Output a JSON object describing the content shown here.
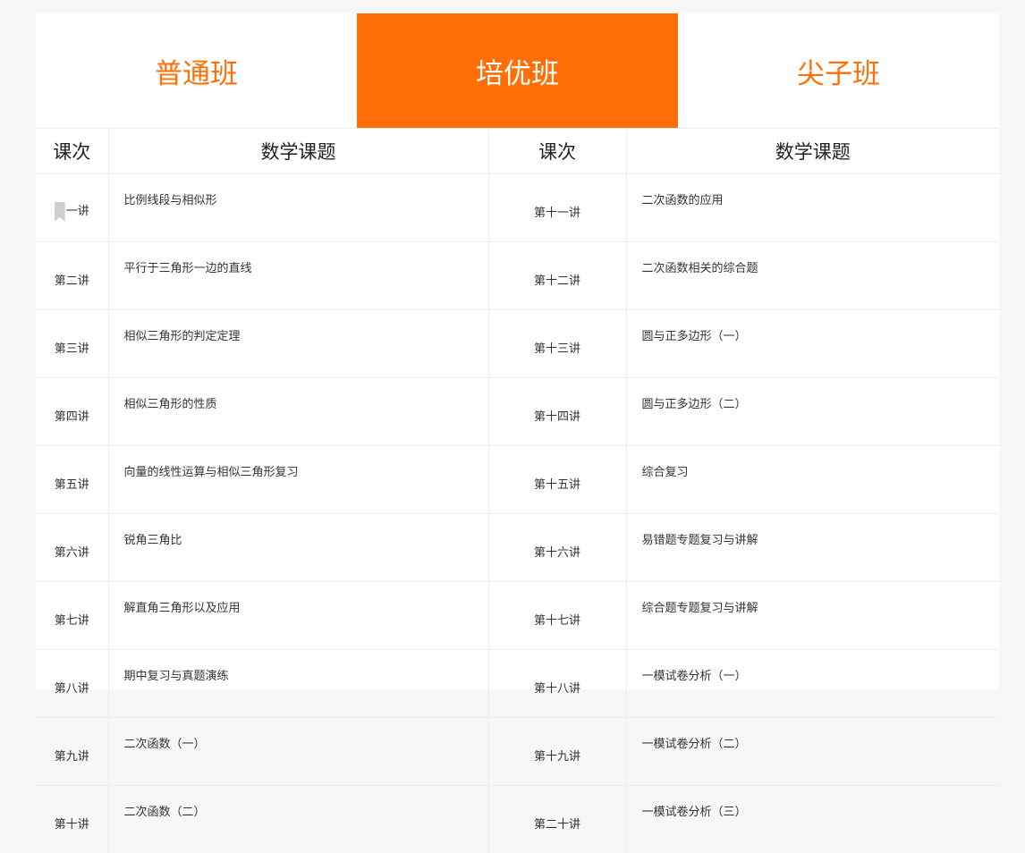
{
  "tabs": [
    {
      "label": "普通班",
      "active": false
    },
    {
      "label": "培优班",
      "active": true
    },
    {
      "label": "尖子班",
      "active": false
    }
  ],
  "table": {
    "headers": [
      "课次",
      "数学课题",
      "课次",
      "数学课题"
    ],
    "first_lesson_visible_text": "一讲",
    "rows": [
      {
        "l1": "第一讲",
        "t1": "比例线段与相似形",
        "l2": "第十一讲",
        "t2": "二次函数的应用"
      },
      {
        "l1": "第二讲",
        "t1": "平行于三角形一边的直线",
        "l2": "第十二讲",
        "t2": "二次函数相关的综合题"
      },
      {
        "l1": "第三讲",
        "t1": "相似三角形的判定定理",
        "l2": "第十三讲",
        "t2": "圆与正多边形（一）"
      },
      {
        "l1": "第四讲",
        "t1": "相似三角形的性质",
        "l2": "第十四讲",
        "t2": "圆与正多边形（二）"
      },
      {
        "l1": "第五讲",
        "t1": "向量的线性运算与相似三角形复习",
        "l2": "第十五讲",
        "t2": "综合复习"
      },
      {
        "l1": "第六讲",
        "t1": "锐角三角比",
        "l2": "第十六讲",
        "t2": "易错题专题复习与讲解"
      },
      {
        "l1": "第七讲",
        "t1": "解直角三角形以及应用",
        "l2": "第十七讲",
        "t2": "综合题专题复习与讲解"
      },
      {
        "l1": "第八讲",
        "t1": "期中复习与真题演练",
        "l2": "第十八讲",
        "t2": "一模试卷分析（一）"
      },
      {
        "l1": "第九讲",
        "t1": "二次函数（一）",
        "l2": "第十九讲",
        "t2": "一模试卷分析（二）"
      },
      {
        "l1": "第十讲",
        "t1": "二次函数（二）",
        "l2": "第二十讲",
        "t2": "一模试卷分析（三）"
      }
    ]
  },
  "colors": {
    "accent": "#ff6f06",
    "border": "#eeeeee",
    "background": "#f7f7f7"
  },
  "icons": {
    "overlay": "bookmark-icon"
  }
}
